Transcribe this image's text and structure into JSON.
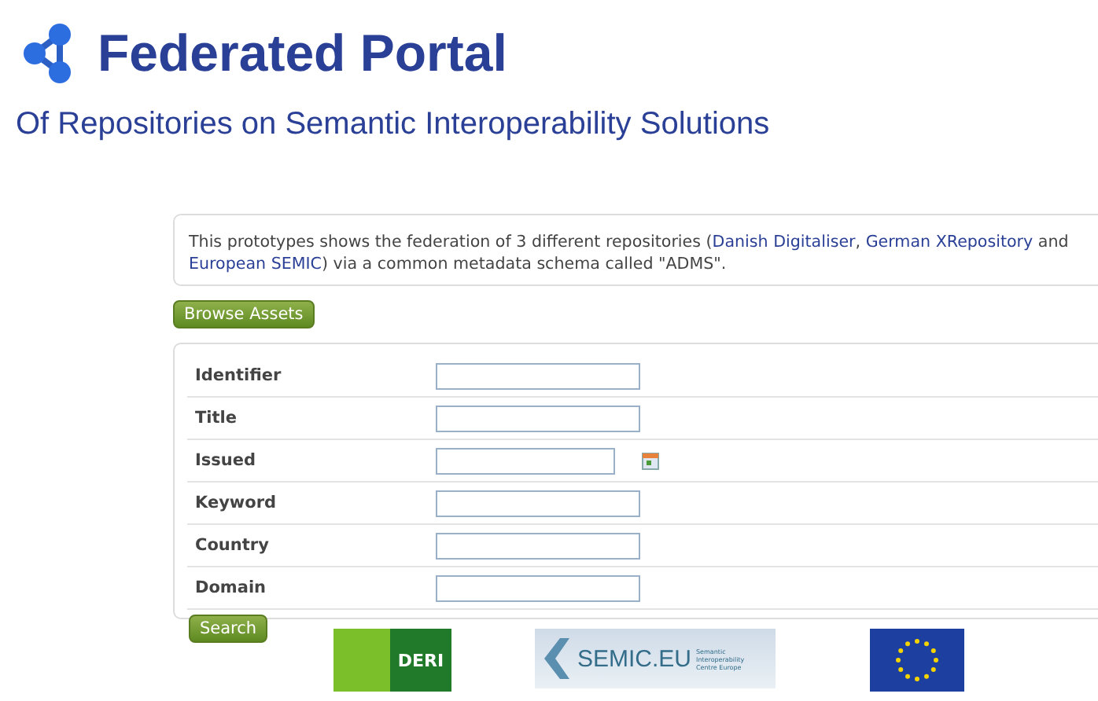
{
  "header": {
    "title": "Federated Portal",
    "subtitle": "Of Repositories on Semantic Interoperability Solutions"
  },
  "intro": {
    "parts": [
      {
        "kind": "text",
        "text": "This prototypes shows the federation of 3 different repositories ("
      },
      {
        "kind": "link",
        "text": "Danish Digitaliser"
      },
      {
        "kind": "text",
        "text": ", "
      },
      {
        "kind": "link",
        "text": "German XRepository"
      },
      {
        "kind": "text",
        "text": " and "
      },
      {
        "kind": "link",
        "text": "European SEMIC"
      },
      {
        "kind": "text",
        "text": ") via a common metadata schema called \"ADMS\"."
      }
    ]
  },
  "browse_button": "Browse Assets",
  "form": {
    "fields": [
      {
        "label": "Identifier",
        "kind": "text"
      },
      {
        "label": "Title",
        "kind": "text"
      },
      {
        "label": "Issued",
        "kind": "date"
      },
      {
        "label": "Keyword",
        "kind": "text"
      },
      {
        "label": "Country",
        "kind": "text"
      },
      {
        "label": "Domain",
        "kind": "text"
      }
    ],
    "search_button": "Search"
  },
  "footer_logos": [
    {
      "kind": "deri",
      "text": "DERI"
    },
    {
      "kind": "semic",
      "text": "SEMIC.EU",
      "subtext": "Semantic Interoperability Centre Europe"
    },
    {
      "kind": "eu"
    }
  ]
}
